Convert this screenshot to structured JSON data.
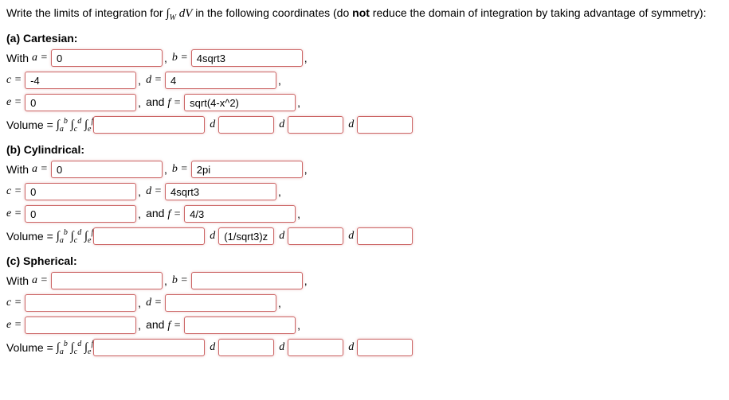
{
  "prompt": {
    "pre": "Write the limits of integration for ",
    "integral": "∫",
    "sub": "W",
    "dV": " dV",
    "post": " in the following coordinates (do ",
    "not": "not",
    "post2": " reduce the domain of integration by taking advantage of symmetry):"
  },
  "labels": {
    "with_a": "With ",
    "a_eq": "a =",
    "b_eq": "b =",
    "c_eq": "c =",
    "d_eq": "d =",
    "e_eq": "e =",
    "and_f_eq": "and  f =",
    "volume_eq": "Volume = ",
    "d": "d",
    "comma": ","
  },
  "triple_int": {
    "int": "∫",
    "a": "a",
    "b": "b",
    "c": "c",
    "d": "d",
    "e": "e",
    "f": "f"
  },
  "parts": {
    "a": {
      "title": "(a) Cartesian:",
      "a": "0",
      "b": "4sqrt3",
      "c": "-4",
      "d": "4",
      "e": "0",
      "f": "sqrt(4-x^2)",
      "integrand": "",
      "d1": "",
      "d2": "",
      "d3": ""
    },
    "b": {
      "title": "(b) Cylindrical:",
      "a": "0",
      "b": "2pi",
      "c": "0",
      "d": "4sqrt3",
      "e": "0",
      "f": "4/3",
      "integrand": "",
      "d1": "(1/sqrt3)z",
      "d2": "",
      "d3": ""
    },
    "c": {
      "title": "(c) Spherical:",
      "a": "",
      "b": "",
      "c": "",
      "d": "",
      "e": "",
      "f": "",
      "integrand": "",
      "d1": "",
      "d2": "",
      "d3": ""
    }
  }
}
